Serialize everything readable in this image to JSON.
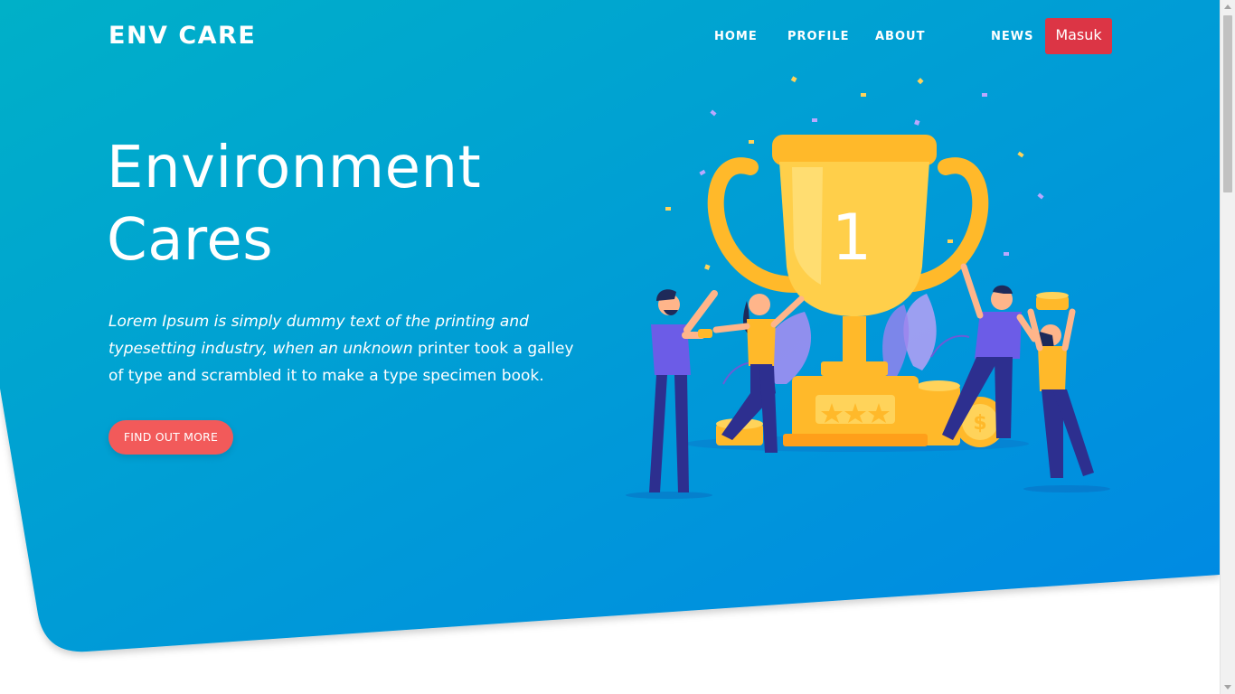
{
  "brand": {
    "name": "ENV CARE"
  },
  "nav": {
    "items": [
      {
        "label": "HOME"
      },
      {
        "label": "PROFILE"
      },
      {
        "label": "ABOUT"
      },
      {
        "label": "NEWS"
      }
    ],
    "login_label": "Masuk"
  },
  "hero": {
    "title_line1": "Environment",
    "title_line2": "Cares",
    "lead_italic": "Lorem Ipsum is simply dummy text of the printing and typesetting industry, when an unknown",
    "lead_regular": " printer took a galley of type and scrambled it to make a type specimen book.",
    "cta_label": "FIND OUT MORE"
  },
  "illustration": {
    "trophy_number": "1"
  },
  "colors": {
    "gradient_start": "#00b0c8",
    "gradient_end": "#0088e4",
    "login_button": "#dc3545",
    "cta_button": "#f25a5a",
    "trophy": "#ffb92a"
  }
}
